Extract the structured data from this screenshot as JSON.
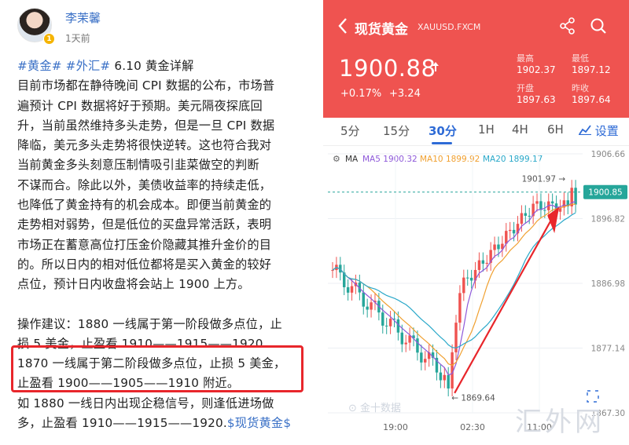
{
  "post": {
    "author": "李茉馨",
    "verified_badge": "1",
    "time": "1天前",
    "tag1": "#黄金#",
    "tag2": "#外汇#",
    "title": "6.10 黄金详解",
    "lines": [
      "目前市场都在静待晚间 CPI 数据的公布，市场普",
      "遍预计 CPI 数据将好于预期。美元隔夜探底回",
      "升，当前虽然维持多头走势，但是一旦 CPI 数据",
      "降临，美元多头走势将很快逆转。这也符合我对",
      "当前黄金多头刻意压制情吸引韭菜做空的判断",
      "不谋而合。除此以外，美债收益率的持续走低，",
      "也降低了黄金持有的机会成本。即便当前黄金的",
      "走势相对弱势，但是低位的买盘异常活跃，表明",
      "市场正在蓄意高位打压金价隐藏其推升金价的目",
      "的。所以日内的相对低位都将是买入黄金的较好",
      "点位，预计日内收盘将会站上 1900 上方。"
    ],
    "advice_lines": [
      "操作建议：1880 一线属于第一阶段做多点位，止",
      "损 5 美金，止盈看 1910——1915——1920",
      "1870 一线属于第二阶段做多点位，止损 5 美金，",
      "止盈看 1900——1905——1910 附近。",
      "如 1880 一线日内出现企稳信号，则逢低进场做"
    ],
    "last_line_text": "多，止盈看 1910——1915——1920.",
    "last_line_tag": "$现货黄金$"
  },
  "app": {
    "back_icon": "chevron-left-icon",
    "title": "现货黄金",
    "symbol": "XAUUSD.FXCM",
    "price": "1900.88",
    "pct_change": "+0.17%",
    "abs_change": "+3.24",
    "stats": [
      {
        "label": "最高",
        "value": "1902.37"
      },
      {
        "label": "最低",
        "value": "1897.12"
      },
      {
        "label": "开盘",
        "value": "1897.63"
      },
      {
        "label": "昨收",
        "value": "1897.64"
      }
    ],
    "tabs": [
      "5分",
      "15分",
      "30分",
      "1H",
      "4H",
      "6H"
    ],
    "active_tab": "30分",
    "settings_label": "设置",
    "colors": {
      "header": "#ef5350",
      "up": "#ef5350",
      "down": "#26a69a",
      "accent": "#2e6bd6"
    }
  },
  "chart_data": {
    "type": "candlestick",
    "ma_label": "MA",
    "ma": [
      {
        "name": "MA5",
        "value": "1900.32",
        "color": "#8e59d9"
      },
      {
        "name": "MA10",
        "value": "1899.92",
        "color": "#f0a030"
      },
      {
        "name": "MA20",
        "value": "1899.17",
        "color": "#29a8c9"
      }
    ],
    "y_ticks": [
      "1906.66",
      "1896.82",
      "1886.98",
      "1877.14",
      "1867.30"
    ],
    "ylim": [
      1867.3,
      1906.66
    ],
    "x_ticks": [
      "19:00",
      "02:30",
      "11:00"
    ],
    "current_price_tag": "1900.85",
    "high_annotation": "1901.97",
    "low_annotation": "1869.64",
    "watermark": "金十数据"
  },
  "site_watermark": "汇外网"
}
